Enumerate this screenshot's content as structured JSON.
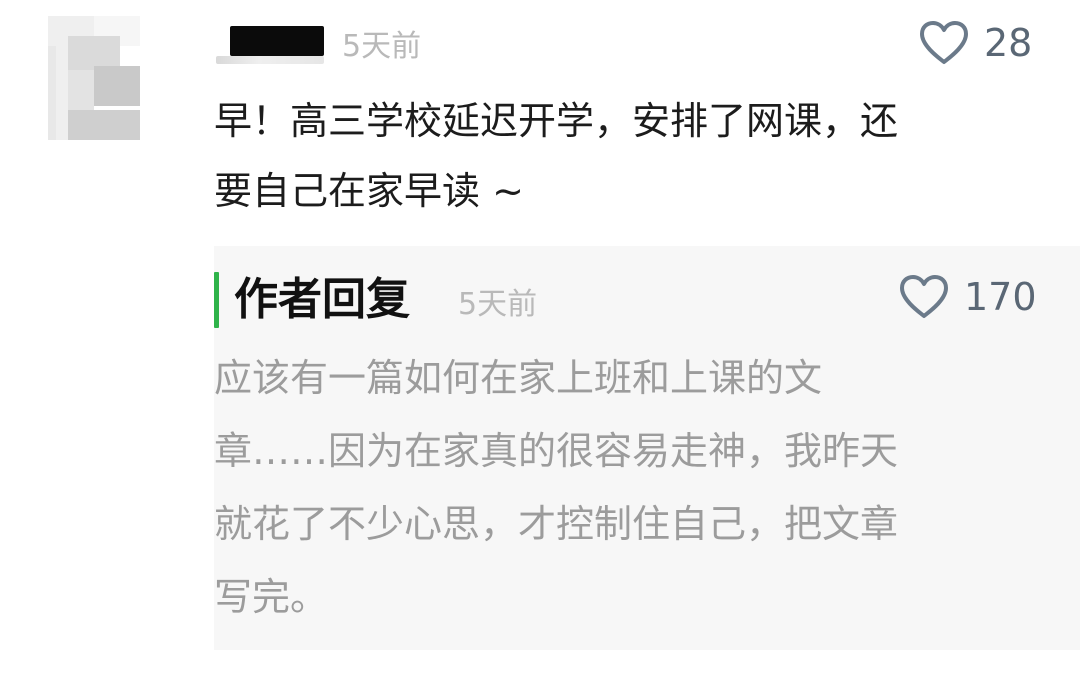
{
  "comment": {
    "time": "5天前",
    "likes": "28",
    "lines": [
      "早！高三学校延迟开学，安排了网课，还",
      "要自己在家早读 ~"
    ]
  },
  "reply": {
    "title": "作者回复",
    "time": "5天前",
    "likes": "170",
    "lines": [
      "应该有一篇如何在家上班和上课的文",
      "章……因为在家真的很容易走神，我昨天",
      "就花了不少心思，才控制住自己，把文章",
      "写完。"
    ]
  },
  "icons": {
    "like": "heart-outline-icon"
  },
  "colors": {
    "accent_bar": "#2fb34a",
    "time_text": "#b9b9b9",
    "like_count": "#5a6775",
    "reply_text": "#9c9c9c",
    "reply_bg": "#f7f7f7"
  }
}
